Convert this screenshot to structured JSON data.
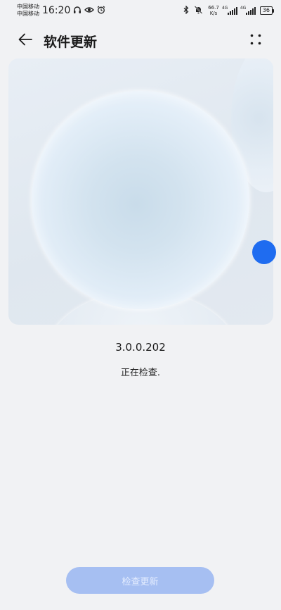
{
  "status_bar": {
    "carrier_1": "中国移动",
    "carrier_2": "中国移动",
    "time": "16:20",
    "net_speed_value": "66.7",
    "net_speed_unit": "K/s",
    "signal_1_tag": "4G",
    "signal_2_tag": "4G",
    "battery": "36",
    "icons": [
      "headphones-icon",
      "eye-icon",
      "alarm-icon",
      "bluetooth-icon",
      "mute-bell-icon",
      "signal-icon",
      "battery-icon"
    ]
  },
  "header": {
    "title": "软件更新",
    "back_icon": "arrow-left-icon",
    "more_icon": "four-dots-icon"
  },
  "main": {
    "version": "3.0.0.202",
    "status": "正在检查."
  },
  "footer": {
    "check_button_label": "检查更新"
  },
  "colors": {
    "background": "#f1f2f4",
    "accent_dot": "#1f6cf0",
    "button_disabled": "#a6bff2"
  }
}
